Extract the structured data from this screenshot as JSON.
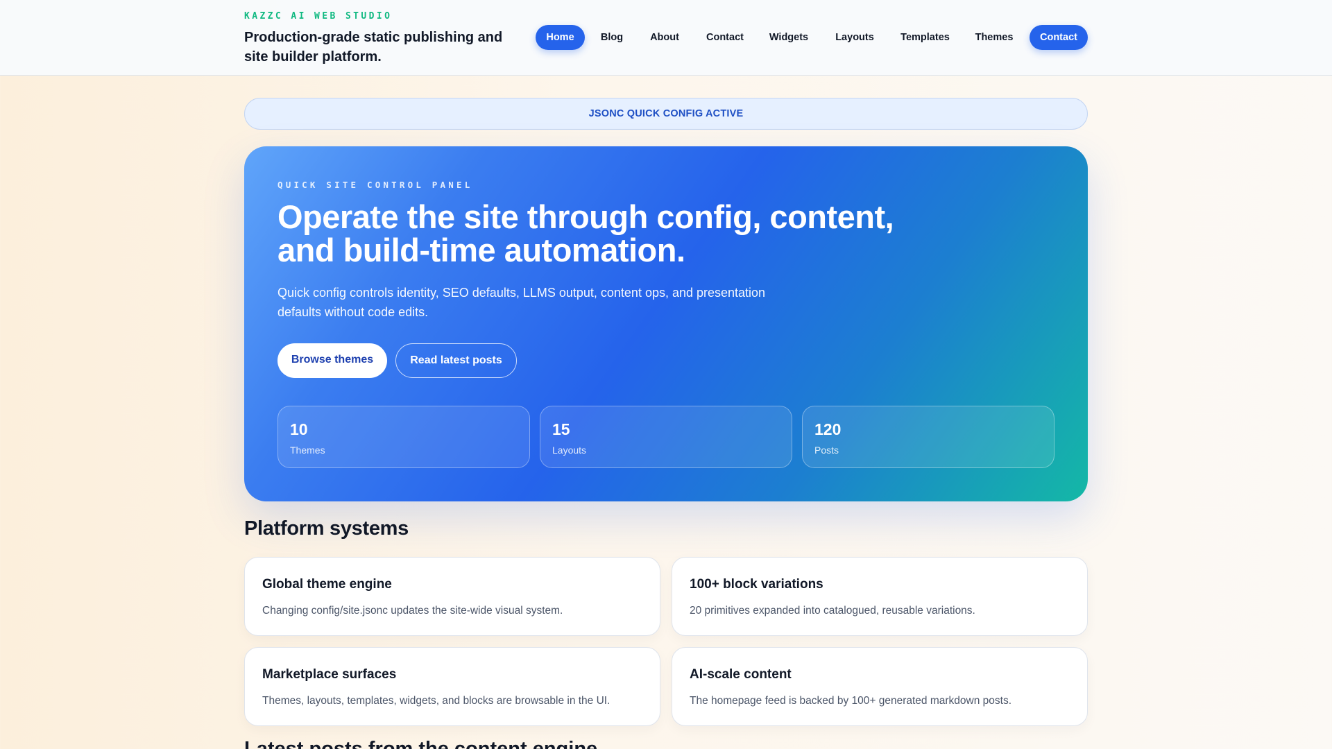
{
  "header": {
    "brand_kicker": "KAZZC AI WEB STUDIO",
    "brand_tagline": "Production-grade static publishing and site builder platform.",
    "nav": [
      {
        "label": "Home",
        "active": true
      },
      {
        "label": "Blog"
      },
      {
        "label": "About"
      },
      {
        "label": "Contact"
      },
      {
        "label": "Widgets"
      },
      {
        "label": "Layouts"
      },
      {
        "label": "Templates"
      },
      {
        "label": "Themes"
      }
    ],
    "cta_label": "Contact"
  },
  "banner": {
    "text": "JSONC QUICK CONFIG ACTIVE"
  },
  "hero": {
    "kicker": "QUICK SITE CONTROL PANEL",
    "title": "Operate the site through config, content, and build-time automation.",
    "description": "Quick config controls identity, SEO defaults, LLMS output, content ops, and presentation defaults without code edits.",
    "primary_button": "Browse themes",
    "secondary_button": "Read latest posts",
    "stats": [
      {
        "value": "10",
        "label": "Themes"
      },
      {
        "value": "15",
        "label": "Layouts"
      },
      {
        "value": "120",
        "label": "Posts"
      }
    ]
  },
  "platform": {
    "title": "Platform systems",
    "cards": [
      {
        "title": "Global theme engine",
        "description": "Changing config/site.jsonc updates the site-wide visual system."
      },
      {
        "title": "100+ block variations",
        "description": "20 primitives expanded into catalogued, reusable variations."
      },
      {
        "title": "Marketplace surfaces",
        "description": "Themes, layouts, templates, widgets, and blocks are browsable in the UI."
      },
      {
        "title": "AI-scale content",
        "description": "The homepage feed is backed by 100+ generated markdown posts."
      }
    ]
  },
  "next_section": {
    "title": "Latest posts from the content engine"
  },
  "colors": {
    "accent": "#2563eb",
    "brand_kicker": "#10b981",
    "hero_end": "#14b8a6"
  }
}
